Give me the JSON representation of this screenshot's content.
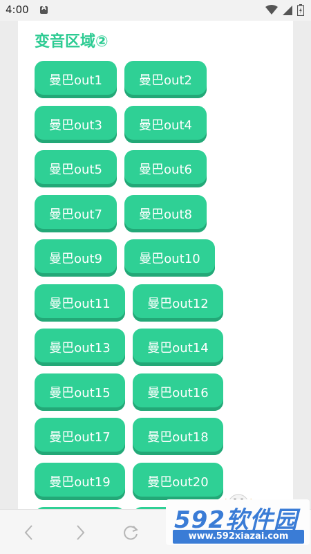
{
  "status_bar": {
    "time": "4:00",
    "notification_icon": "A"
  },
  "section": {
    "title": "变音区域②"
  },
  "buttons": [
    "曼巴out1",
    "曼巴out2",
    "曼巴out3",
    "曼巴out4",
    "曼巴out5",
    "曼巴out6",
    "曼巴out7",
    "曼巴out8",
    "曼巴out9",
    "曼巴out10",
    "曼巴out11",
    "曼巴out12",
    "曼巴out13",
    "曼巴out14",
    "曼巴out15",
    "曼巴out16",
    "曼巴out17",
    "曼巴out18",
    "曼巴out19",
    "曼巴out20"
  ],
  "watermark": {
    "logo_text": "592软件园",
    "url_text": "www.592xiazai.com"
  },
  "colors": {
    "accent": "#2fd095",
    "accent_dark": "#23a877",
    "title": "#2ccb92",
    "watermark_blue": "#3a7cd6"
  },
  "icons": [
    "wifi-icon",
    "signal-icon",
    "battery-icon",
    "back-arrow-icon",
    "forward-arrow-icon",
    "refresh-icon"
  ]
}
